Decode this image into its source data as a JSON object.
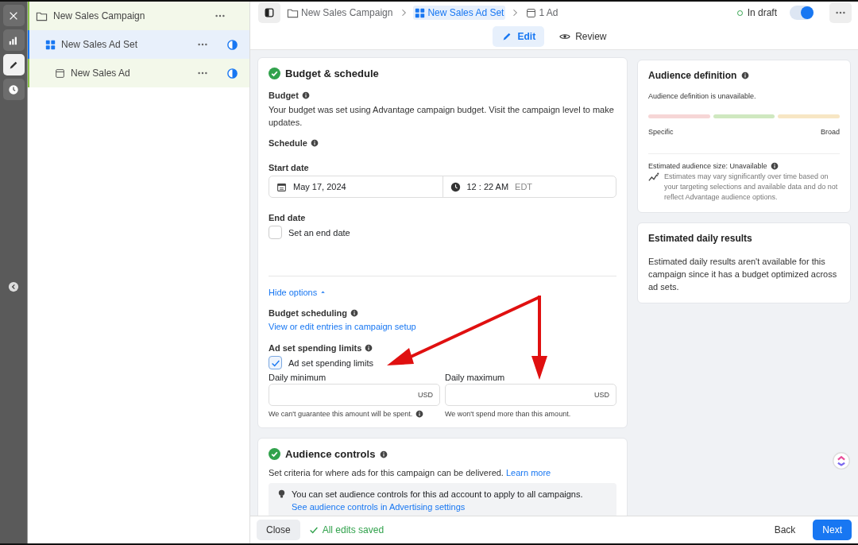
{
  "rail": {
    "items": [
      {
        "kind": "close",
        "selected": false
      },
      {
        "kind": "chart",
        "selected": false
      },
      {
        "kind": "edit",
        "selected": true
      },
      {
        "kind": "history",
        "selected": false
      }
    ]
  },
  "tree": {
    "items": [
      {
        "kind": "campaign",
        "label": "New Sales Campaign",
        "selected": false,
        "children": [
          {
            "kind": "adset",
            "label": "New Sales Ad Set",
            "selected": true,
            "children": [
              {
                "kind": "ad",
                "label": "New Sales Ad",
                "selected": false
              }
            ]
          }
        ]
      }
    ]
  },
  "breadcrumbs": [
    {
      "kind": "campaign",
      "label": "New Sales Campaign",
      "selected": false
    },
    {
      "kind": "adset",
      "label": "New Sales Ad Set",
      "selected": true
    },
    {
      "kind": "ad",
      "label": "1 Ad",
      "selected": false
    }
  ],
  "status": {
    "label": "In draft",
    "on": true
  },
  "tabs": [
    {
      "kind": "edit",
      "label": "Edit",
      "selected": true
    },
    {
      "kind": "review",
      "label": "Review",
      "selected": false
    }
  ],
  "budget_card": {
    "title": "Budget & schedule",
    "budget_label": "Budget",
    "budget_text": "Your budget was set using Advantage campaign budget. Visit the campaign level to make updates.",
    "schedule_label": "Schedule",
    "start_label": "Start date",
    "start_date": "May 17, 2024",
    "start_time": "12 : 22 AM",
    "timezone": "EDT",
    "end_label": "End date",
    "end_checkbox": {
      "label": "Set an end date",
      "checked": false
    },
    "hide_options": "Hide options",
    "scheduling_label": "Budget scheduling",
    "scheduling_link": "View or edit entries in campaign setup",
    "limits_label": "Ad set spending limits",
    "limits_checkbox": {
      "label": "Ad set spending limits",
      "checked": true
    },
    "limits": [
      {
        "label": "Daily minimum",
        "currency": "USD",
        "hint": "We can't guarantee this amount will be spent.",
        "info": true
      },
      {
        "label": "Daily maximum",
        "currency": "USD",
        "hint": "We won't spend more than this amount.",
        "info": false
      }
    ]
  },
  "audience_controls": {
    "title": "Audience controls",
    "text": "Set criteria for where ads for this campaign can be delivered.",
    "link": "Learn more",
    "tip": "You can set audience controls for this ad account to apply to all campaigns.",
    "tip_link": "See audience controls in Advertising settings"
  },
  "audience_definition": {
    "title": "Audience definition",
    "text": "Audience definition is unavailable.",
    "segments": [
      {
        "color": "#f6d6d6"
      },
      {
        "color": "#cfe8c0"
      },
      {
        "color": "#f7e6c4"
      }
    ],
    "left_label": "Specific",
    "right_label": "Broad",
    "size": "Estimated audience size: Unavailable",
    "note": "Estimates may vary significantly over time based on your targeting selections and available data and do not reflect Advantage audience options."
  },
  "daily_results": {
    "title": "Estimated daily results",
    "text": "Estimated daily results aren't available for this campaign since it has a budget optimized across ad sets."
  },
  "footer": {
    "close": "Close",
    "saved": "All edits saved",
    "back": "Back",
    "next": "Next"
  }
}
